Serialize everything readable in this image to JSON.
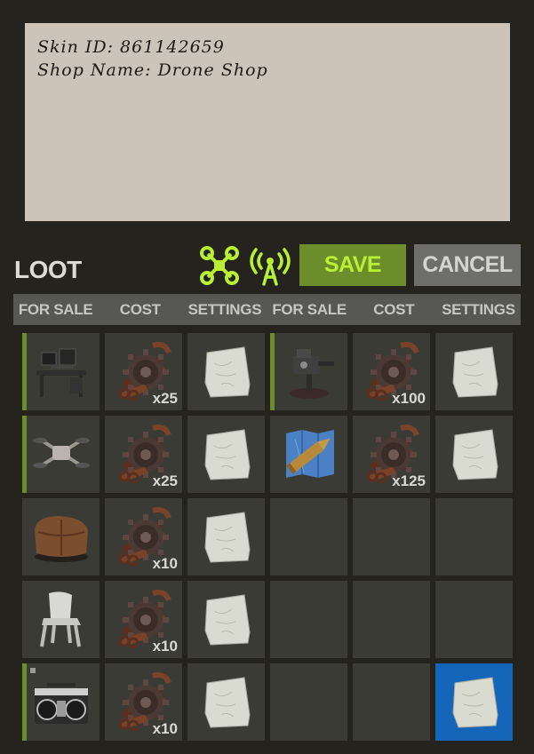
{
  "note": {
    "line1": "Skin ID: 861142659",
    "line2": "Shop Name: Drone Shop"
  },
  "panel": {
    "title": "LOOT",
    "save_label": "SAVE",
    "cancel_label": "CANCEL",
    "icons": [
      "drone-icon",
      "broadcast-tower-icon"
    ],
    "colors": {
      "accent": "#b9f034",
      "save_bg": "#6d8c2c",
      "cancel_bg": "#6e6e6c",
      "selected": "#1565b8"
    }
  },
  "columns": [
    "FOR SALE",
    "COST",
    "SETTINGS",
    "FOR SALE",
    "COST",
    "SETTINGS"
  ],
  "grid": {
    "r1": {
      "item1": "computer-station-icon",
      "cost1": "x25",
      "item2": "auto-turret-icon",
      "cost2": "x100"
    },
    "r2": {
      "item1": "drone-icon",
      "cost1": "x25",
      "item2": "ammo-map-icon",
      "cost2": "x125"
    },
    "r3": {
      "item1": "brown-sack-icon",
      "cost1": "x10"
    },
    "r4": {
      "item1": "plastic-chair-icon",
      "cost1": "x10"
    },
    "r5": {
      "item1": "boombox-icon",
      "cost1": "x10"
    }
  }
}
